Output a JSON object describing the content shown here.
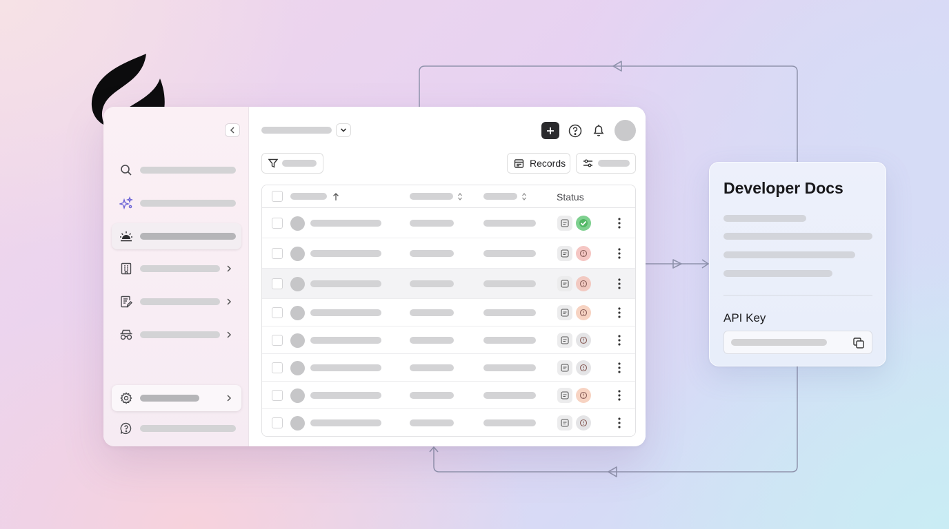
{
  "table": {
    "status_header": "Status",
    "rows": [
      {
        "status": "success",
        "status_color": "#7ed08f"
      },
      {
        "status": "warning",
        "status_color": "#f5c6c3"
      },
      {
        "status": "warning",
        "status_color": "#f2c9c1"
      },
      {
        "status": "pending",
        "status_color": "#f7d3c2"
      },
      {
        "status": "neutral",
        "status_color": "#e4e4e6"
      },
      {
        "status": "neutral",
        "status_color": "#e4e4e6"
      },
      {
        "status": "warning",
        "status_color": "#f7d3c2"
      },
      {
        "status": "neutral",
        "status_color": "#e4e4e6"
      }
    ]
  },
  "toolbar": {
    "records_label": "Records"
  },
  "docs_card": {
    "title": "Developer Docs",
    "api_key_label": "API Key"
  },
  "colors": {
    "add_button": "#2b2b2e",
    "ai_icon": "#6b63d6",
    "connector_line": "#8f93ac"
  },
  "icons": {
    "sidebar": [
      "search-icon",
      "sparkle-icon",
      "sunrise-icon",
      "building-icon",
      "document-edit-icon",
      "incognito-icon",
      "gear-icon",
      "help-circle-icon"
    ],
    "topbar": [
      "plus-icon",
      "help-circle-icon",
      "bell-icon",
      "avatar"
    ],
    "toolbar": [
      "filter-icon",
      "calendar-icon",
      "sliders-icon"
    ],
    "docs": [
      "copy-icon"
    ]
  }
}
